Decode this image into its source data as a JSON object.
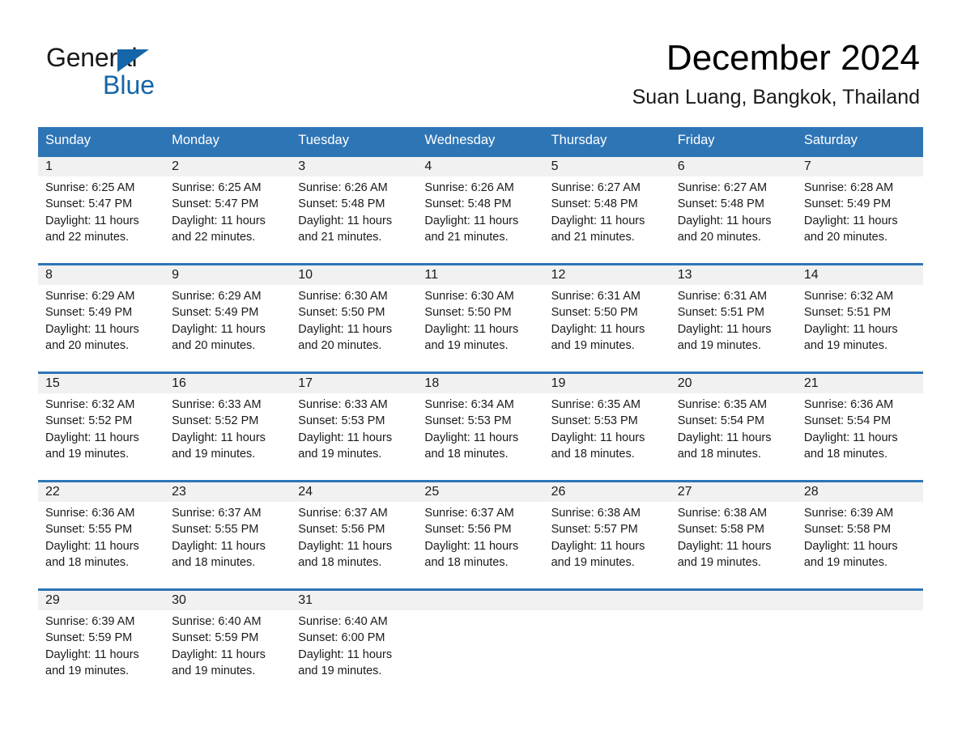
{
  "brand": {
    "name_part1": "General",
    "name_part2": "Blue",
    "accent_color": "#1565a8",
    "triangle_icon": "triangle-icon"
  },
  "header": {
    "month_title": "December 2024",
    "location": "Suan Luang, Bangkok, Thailand"
  },
  "calendar": {
    "header_color": "#2E75B6",
    "daynum_band_color": "#F1F1F1",
    "weekday_headers": [
      "Sunday",
      "Monday",
      "Tuesday",
      "Wednesday",
      "Thursday",
      "Friday",
      "Saturday"
    ],
    "weeks": [
      [
        {
          "day": "1",
          "sunrise": "Sunrise: 6:25 AM",
          "sunset": "Sunset: 5:47 PM",
          "daylight": "Daylight: 11 hours and 22 minutes."
        },
        {
          "day": "2",
          "sunrise": "Sunrise: 6:25 AM",
          "sunset": "Sunset: 5:47 PM",
          "daylight": "Daylight: 11 hours and 22 minutes."
        },
        {
          "day": "3",
          "sunrise": "Sunrise: 6:26 AM",
          "sunset": "Sunset: 5:48 PM",
          "daylight": "Daylight: 11 hours and 21 minutes."
        },
        {
          "day": "4",
          "sunrise": "Sunrise: 6:26 AM",
          "sunset": "Sunset: 5:48 PM",
          "daylight": "Daylight: 11 hours and 21 minutes."
        },
        {
          "day": "5",
          "sunrise": "Sunrise: 6:27 AM",
          "sunset": "Sunset: 5:48 PM",
          "daylight": "Daylight: 11 hours and 21 minutes."
        },
        {
          "day": "6",
          "sunrise": "Sunrise: 6:27 AM",
          "sunset": "Sunset: 5:48 PM",
          "daylight": "Daylight: 11 hours and 20 minutes."
        },
        {
          "day": "7",
          "sunrise": "Sunrise: 6:28 AM",
          "sunset": "Sunset: 5:49 PM",
          "daylight": "Daylight: 11 hours and 20 minutes."
        }
      ],
      [
        {
          "day": "8",
          "sunrise": "Sunrise: 6:29 AM",
          "sunset": "Sunset: 5:49 PM",
          "daylight": "Daylight: 11 hours and 20 minutes."
        },
        {
          "day": "9",
          "sunrise": "Sunrise: 6:29 AM",
          "sunset": "Sunset: 5:49 PM",
          "daylight": "Daylight: 11 hours and 20 minutes."
        },
        {
          "day": "10",
          "sunrise": "Sunrise: 6:30 AM",
          "sunset": "Sunset: 5:50 PM",
          "daylight": "Daylight: 11 hours and 20 minutes."
        },
        {
          "day": "11",
          "sunrise": "Sunrise: 6:30 AM",
          "sunset": "Sunset: 5:50 PM",
          "daylight": "Daylight: 11 hours and 19 minutes."
        },
        {
          "day": "12",
          "sunrise": "Sunrise: 6:31 AM",
          "sunset": "Sunset: 5:50 PM",
          "daylight": "Daylight: 11 hours and 19 minutes."
        },
        {
          "day": "13",
          "sunrise": "Sunrise: 6:31 AM",
          "sunset": "Sunset: 5:51 PM",
          "daylight": "Daylight: 11 hours and 19 minutes."
        },
        {
          "day": "14",
          "sunrise": "Sunrise: 6:32 AM",
          "sunset": "Sunset: 5:51 PM",
          "daylight": "Daylight: 11 hours and 19 minutes."
        }
      ],
      [
        {
          "day": "15",
          "sunrise": "Sunrise: 6:32 AM",
          "sunset": "Sunset: 5:52 PM",
          "daylight": "Daylight: 11 hours and 19 minutes."
        },
        {
          "day": "16",
          "sunrise": "Sunrise: 6:33 AM",
          "sunset": "Sunset: 5:52 PM",
          "daylight": "Daylight: 11 hours and 19 minutes."
        },
        {
          "day": "17",
          "sunrise": "Sunrise: 6:33 AM",
          "sunset": "Sunset: 5:53 PM",
          "daylight": "Daylight: 11 hours and 19 minutes."
        },
        {
          "day": "18",
          "sunrise": "Sunrise: 6:34 AM",
          "sunset": "Sunset: 5:53 PM",
          "daylight": "Daylight: 11 hours and 18 minutes."
        },
        {
          "day": "19",
          "sunrise": "Sunrise: 6:35 AM",
          "sunset": "Sunset: 5:53 PM",
          "daylight": "Daylight: 11 hours and 18 minutes."
        },
        {
          "day": "20",
          "sunrise": "Sunrise: 6:35 AM",
          "sunset": "Sunset: 5:54 PM",
          "daylight": "Daylight: 11 hours and 18 minutes."
        },
        {
          "day": "21",
          "sunrise": "Sunrise: 6:36 AM",
          "sunset": "Sunset: 5:54 PM",
          "daylight": "Daylight: 11 hours and 18 minutes."
        }
      ],
      [
        {
          "day": "22",
          "sunrise": "Sunrise: 6:36 AM",
          "sunset": "Sunset: 5:55 PM",
          "daylight": "Daylight: 11 hours and 18 minutes."
        },
        {
          "day": "23",
          "sunrise": "Sunrise: 6:37 AM",
          "sunset": "Sunset: 5:55 PM",
          "daylight": "Daylight: 11 hours and 18 minutes."
        },
        {
          "day": "24",
          "sunrise": "Sunrise: 6:37 AM",
          "sunset": "Sunset: 5:56 PM",
          "daylight": "Daylight: 11 hours and 18 minutes."
        },
        {
          "day": "25",
          "sunrise": "Sunrise: 6:37 AM",
          "sunset": "Sunset: 5:56 PM",
          "daylight": "Daylight: 11 hours and 18 minutes."
        },
        {
          "day": "26",
          "sunrise": "Sunrise: 6:38 AM",
          "sunset": "Sunset: 5:57 PM",
          "daylight": "Daylight: 11 hours and 19 minutes."
        },
        {
          "day": "27",
          "sunrise": "Sunrise: 6:38 AM",
          "sunset": "Sunset: 5:58 PM",
          "daylight": "Daylight: 11 hours and 19 minutes."
        },
        {
          "day": "28",
          "sunrise": "Sunrise: 6:39 AM",
          "sunset": "Sunset: 5:58 PM",
          "daylight": "Daylight: 11 hours and 19 minutes."
        }
      ],
      [
        {
          "day": "29",
          "sunrise": "Sunrise: 6:39 AM",
          "sunset": "Sunset: 5:59 PM",
          "daylight": "Daylight: 11 hours and 19 minutes."
        },
        {
          "day": "30",
          "sunrise": "Sunrise: 6:40 AM",
          "sunset": "Sunset: 5:59 PM",
          "daylight": "Daylight: 11 hours and 19 minutes."
        },
        {
          "day": "31",
          "sunrise": "Sunrise: 6:40 AM",
          "sunset": "Sunset: 6:00 PM",
          "daylight": "Daylight: 11 hours and 19 minutes."
        },
        {
          "day": "",
          "sunrise": "",
          "sunset": "",
          "daylight": ""
        },
        {
          "day": "",
          "sunrise": "",
          "sunset": "",
          "daylight": ""
        },
        {
          "day": "",
          "sunrise": "",
          "sunset": "",
          "daylight": ""
        },
        {
          "day": "",
          "sunrise": "",
          "sunset": "",
          "daylight": ""
        }
      ]
    ]
  }
}
